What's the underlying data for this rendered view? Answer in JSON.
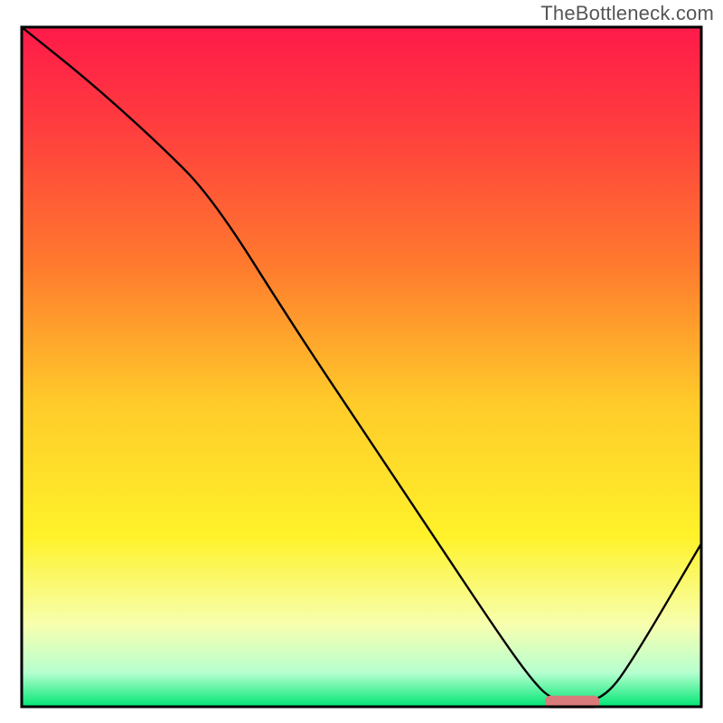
{
  "watermark": "TheBottleneck.com",
  "chart_data": {
    "type": "line",
    "title": "",
    "xlabel": "",
    "ylabel": "",
    "xlim": [
      0,
      100
    ],
    "ylim": [
      0,
      100
    ],
    "grid": false,
    "legend": false,
    "series": [
      {
        "name": "curve",
        "x": [
          0,
          10,
          20,
          28,
          40,
          50,
          60,
          70,
          75,
          78,
          82,
          86,
          90,
          100
        ],
        "y": [
          100,
          92,
          83,
          75,
          56,
          41,
          26,
          11,
          4,
          1,
          0.5,
          1.5,
          7,
          24
        ]
      }
    ],
    "annotations": [
      {
        "name": "marker-bar",
        "shape": "rounded-rect",
        "color": "#d97b7a",
        "x_range": [
          77,
          85
        ],
        "y": 0.7
      }
    ],
    "background_gradient": {
      "stops": [
        {
          "offset": 0.0,
          "color": "#ff1a4a"
        },
        {
          "offset": 0.15,
          "color": "#ff3e3e"
        },
        {
          "offset": 0.35,
          "color": "#ff7a2e"
        },
        {
          "offset": 0.55,
          "color": "#ffca2a"
        },
        {
          "offset": 0.75,
          "color": "#fff22a"
        },
        {
          "offset": 0.88,
          "color": "#f7ffb0"
        },
        {
          "offset": 0.95,
          "color": "#b6ffcf"
        },
        {
          "offset": 1.0,
          "color": "#00e673"
        }
      ]
    },
    "frame_color": "#000000"
  }
}
